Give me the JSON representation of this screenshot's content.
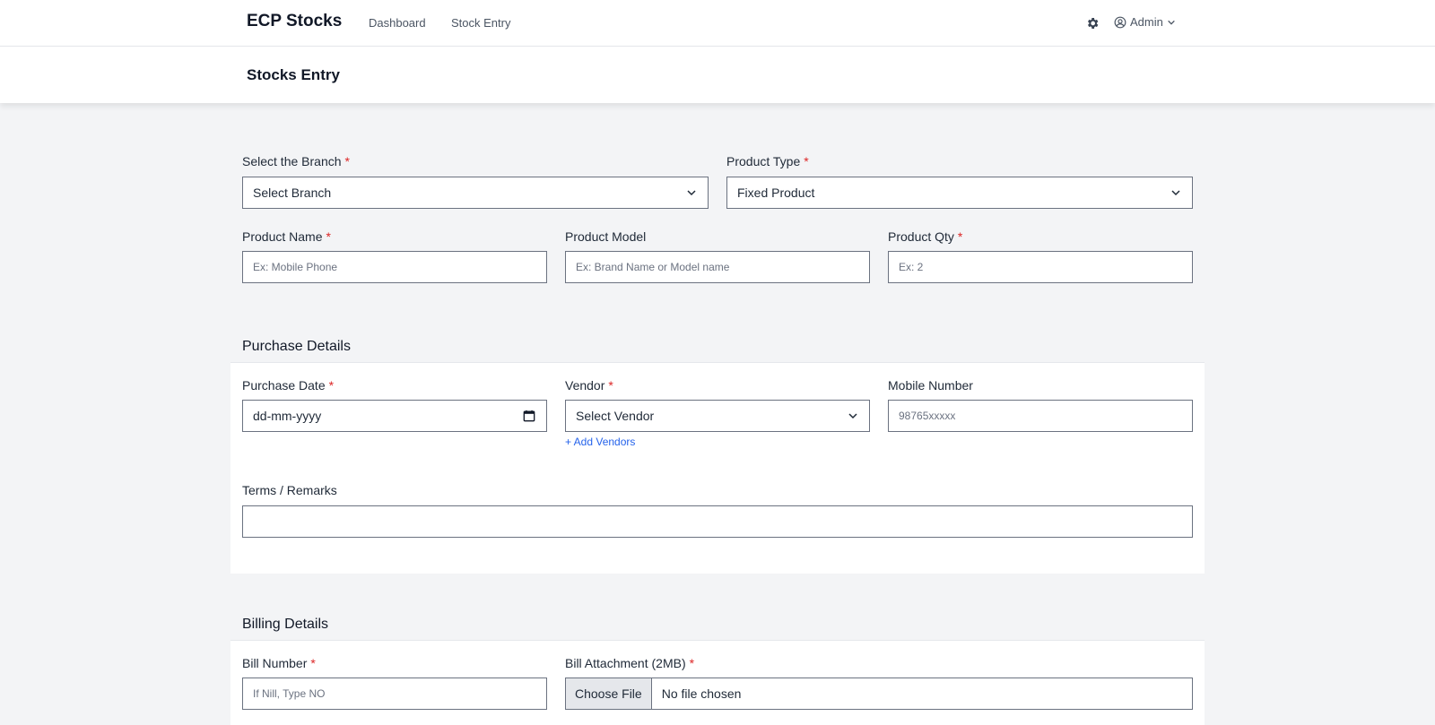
{
  "nav": {
    "brand": "ECP Stocks",
    "links": [
      "Dashboard",
      "Stock Entry"
    ],
    "user": "Admin",
    "settings_icon": "gear-icon",
    "user_icon": "user-circle-icon"
  },
  "page": {
    "title": "Stocks Entry"
  },
  "product": {
    "branch_label": "Select the Branch",
    "branch_value": "Select Branch",
    "type_label": "Product Type",
    "type_value": "Fixed Product",
    "name_label": "Product Name",
    "name_placeholder": "Ex: Mobile Phone",
    "model_label": "Product Model",
    "model_placeholder": "Ex: Brand Name or Model name",
    "qty_label": "Product Qty",
    "qty_placeholder": "Ex: 2",
    "required_mark": "*"
  },
  "purchase": {
    "title": "Purchase Details",
    "date_label": "Purchase Date",
    "date_value": "dd-mm-yyyy",
    "vendor_label": "Vendor",
    "vendor_value": "Select Vendor",
    "add_vendors": "+ Add Vendors",
    "mobile_label": "Mobile Number",
    "mobile_placeholder": "98765xxxxx",
    "remarks_label": "Terms / Remarks"
  },
  "billing": {
    "title": "Billing Details",
    "number_label": "Bill Number",
    "number_placeholder": "If Nill, Type NO",
    "attachment_label": "Bill Attachment (2MB)",
    "choose_file": "Choose File",
    "no_file": "No file chosen"
  },
  "colors": {
    "required": "#dc2626",
    "link": "#2563eb"
  }
}
